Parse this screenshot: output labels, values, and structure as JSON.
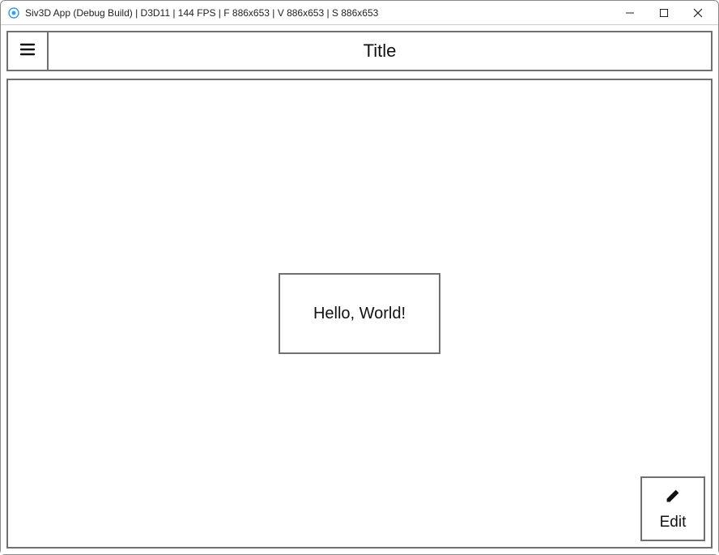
{
  "window": {
    "title": "Siv3D App (Debug Build) | D3D11 | 144 FPS | F 886x653 | V 886x653 | S 886x653"
  },
  "toolbar": {
    "title": "Title"
  },
  "content": {
    "hello_text": "Hello, World!"
  },
  "edit": {
    "label": "Edit"
  }
}
